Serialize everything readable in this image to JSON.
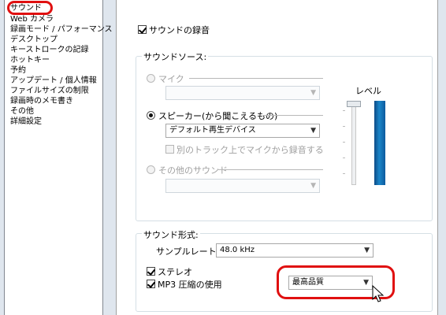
{
  "sidebar": {
    "items": [
      {
        "label": "サウンド"
      },
      {
        "label": "Web カメラ"
      },
      {
        "label": "録画モード / パフォーマンス"
      },
      {
        "label": "デスクトップ"
      },
      {
        "label": "キーストロークの記録"
      },
      {
        "label": "ホットキー"
      },
      {
        "label": "予約"
      },
      {
        "label": "アップデート / 個人情報"
      },
      {
        "label": "ファイルサイズの制限"
      },
      {
        "label": "録画時のメモ書き"
      },
      {
        "label": "その他"
      },
      {
        "label": "詳細設定"
      }
    ]
  },
  "record_sound": {
    "label": "サウンドの録音",
    "checked": true
  },
  "sound_source": {
    "title": "サウンドソース:",
    "mic": {
      "label": "マイク",
      "enabled": false,
      "combo_value": ""
    },
    "speaker": {
      "label": "スピーカー(から聞こえるもの)",
      "selected": true,
      "combo_value": "デフォルト再生デバイス"
    },
    "separate_track": {
      "label": "別のトラック上でマイクから録音する",
      "enabled": false
    },
    "other": {
      "label": "その他のサウンド",
      "enabled": false,
      "combo_value": ""
    },
    "level": {
      "label": "レベル",
      "slider_value": 1.0
    }
  },
  "sound_format": {
    "title": "サウンド形式:",
    "sample_rate_label": "サンプルレート:",
    "sample_rate_value": "48.0 kHz",
    "stereo": {
      "label": "ステレオ",
      "checked": true
    },
    "mp3": {
      "label": "MP3 圧縮の使用",
      "checked": true
    },
    "quality_value": "最高品質"
  },
  "icons": {
    "dropdown": "chevron-down-icon",
    "cursor": "mouse-cursor-icon"
  },
  "colors": {
    "highlight": "#e01010",
    "meter": "#1a86c9"
  }
}
